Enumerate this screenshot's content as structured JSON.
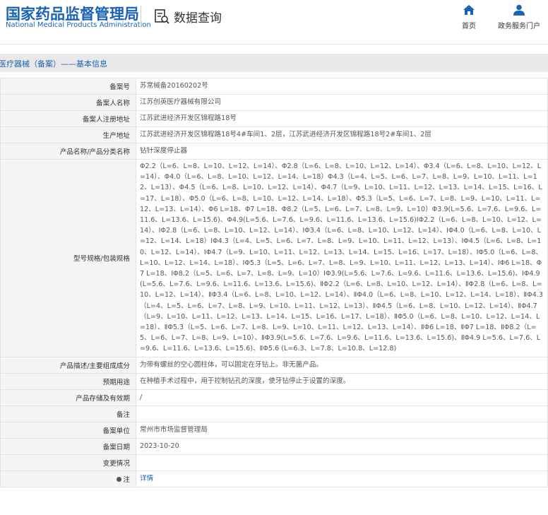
{
  "header": {
    "logo_cn": "国家药品监督管理局",
    "logo_en": "National Medical Products Administration",
    "query_title": "数据查询",
    "nav": [
      {
        "label": "首页",
        "icon": "home-icon"
      },
      {
        "label": "政务服务门户",
        "icon": "user-icon"
      }
    ]
  },
  "breadcrumb": "医疗器械（备案）——基本信息",
  "colors": {
    "brand": "#1a62b4",
    "label_bg": "#f5f5f5",
    "bar_bg": "#e9e9e9"
  },
  "rows": [
    {
      "label": "备案号",
      "value": "苏常械备20160202号"
    },
    {
      "label": "备案人名称",
      "value": "江苏创英医疗器械有限公司"
    },
    {
      "label": "备案人注册地址",
      "value": "江苏武进经济开发区锦程路18号"
    },
    {
      "label": "生产地址",
      "value": "江苏武进经济开发区锦程路18号4#车间1、2层，江苏武进经济开发区锦程路18号2#车间1、2层"
    },
    {
      "label": "产品名称/产品分类名称",
      "value": "钻针深度停止器"
    },
    {
      "label": "型号规格/包装规格",
      "value": "Φ2.2（L=6、L=8、L=10、L=12、L=14）、Φ2.8（L=6、L=8、L=10、L=12、L=14）、Φ3.4（L=6、L=8、L=10、L=12、L=14）、Φ4.0（L=6、L=8、L=10、L=12、L=14、L=18）Φ4.3（L=4、L=5、L=6、L=7、L=8、L=9、L=10、L=11、L=12、L=13）、Φ4.5（L=6、L=8、L=10、L=12、L=14）、Φ4.7（L=9、L=10、L=11、L=12、L=13、L=14、L=15、L=16、L=17、L=18）、Φ5.0（L=6、L=8、L=10、L=12、L=14、L=18）、Φ5.3（L=5、L=6、L=7、L=8、L=9、L=10、L=11、L=12、L=13、L=14）、Φ6 L=18、Φ7 L=18、Φ8.2（L=5、L=6、L=7、L=8、L=9、L=10）Φ3.9(L=5.6、L=7.6、L=9.6、L=11.6、L=13.6、L=15.6)、Φ4.9(L=5.6、L=7.6、L=9.6、L=11.6、L=13.6、L=15.6)ⅠΦ2.2（L=6、L=8、L=10、L=12、L=14）、ⅠΦ2.8（L=6、L=8、L=10、L=12、L=14）、ⅠΦ3.4（L=6、L=8、L=10、L=12、L=14）、ⅠΦ4.0（L=6、L=8、L=10、L=12、L=14、L=18）ⅠΦ4.3（L=4、L=5、L=6、L=7、L=8、L=9、L=10、L=11、L=12、L=13）、ⅠΦ4.5（L=6、L=8、L=10、L=12、L=14）、ⅠΦ4.7（L=9、L=10、L=11、L=12、L=13、L=14、L=15、L=16、L=17、L=18）、ⅠΦ5.0（L=6、L=8、L=10、L=12、L=14、L=18）、ⅠΦ5.3（L=5、L=6、L=7、L=8、L=9、L=10、L=11、L=12、L=13、L=14）、ⅠΦ6 L=18、Φ7 L=18、ⅠΦ8.2（L=5、L=6、L=7、L=8、L=9、L=10）ⅠΦ3.9(L=5.6、L=7.6、L=9.6、L=11.6、L=13.6、L=15.6)、ⅠΦ4.9(L=5.6、L=7.6、L=9.6、L=11.6、L=13.6、L=15.6)、ⅡΦ2.2（L=6、L=8、L=10、L=12、L=14）、ⅡΦ2.8（L=6、L=8、L=10、L=12、L=14）、ⅡΦ3.4（L=6、L=8、L=10、L=12、L=14）、ⅡΦ4.0（L=6、L=8、L=10、L=12、L=14、L=18）、ⅡΦ4.3（L=4、L=5、L=6、L=7、L=8、L=9、L=10、L=11、L=12、L=13）、ⅡΦ4.5（L=6、L=8、L=10、L=12、L=14）、ⅡΦ4.7（L=9、L=10、L=11、L=12、L=13、L=14、L=15、L=16、L=17、L=18）、ⅡΦ5.0（L=6、L=8、L=10、L=12、L=14、L=18）、ⅡΦ5.3（L=5、L=6、L=7、L=8、L=9、L=10、L=11、L=12、L=13、L=14）、ⅡΦ6 L=18、ⅡΦ7 L=18、ⅡΦ8.2（L=5、L=6、L=7、L=8、L=9、L=10）、ⅡΦ3.9(L=5.6、L=7.6、L=9.6、L=11.6、L=13.6、L=15.6)、ⅡΦ4.9 L=5.6、L=7.6、L=9.6、L=11.6、L=13.6、L=15.6)、ⅡΦ5.6 (L=6.3、L=7.8、L=10.8、L=12.8)"
    },
    {
      "label": "产品描述/主要组成成分",
      "value": "为带有螺丝的空心圆柱体，可以固定在牙钻上。非无菌产品。"
    },
    {
      "label": "预期用途",
      "value": "在种植手术过程中，用于控制钻孔的深度，使牙钻停止于设置的深度。"
    },
    {
      "label": "产品存储及有效期",
      "value": "/"
    },
    {
      "label": "备注",
      "value": ""
    },
    {
      "label": "备案单位",
      "value": "常州市市场监督管理局"
    },
    {
      "label": "备案日期",
      "value": "2023-10-20"
    },
    {
      "label": "变更情况",
      "value": ""
    },
    {
      "label": "注",
      "value": "详情"
    }
  ]
}
